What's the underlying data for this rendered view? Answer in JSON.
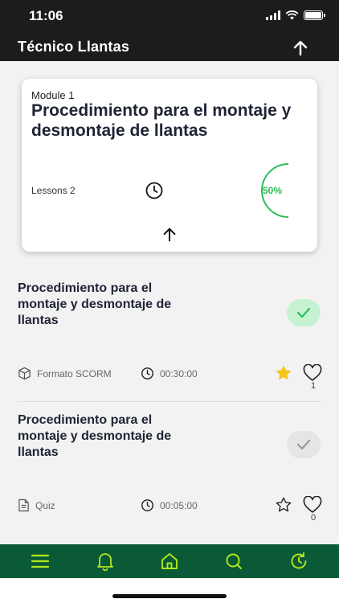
{
  "status_bar": {
    "time": "11:06"
  },
  "header": {
    "title": "Técnico Llantas"
  },
  "module": {
    "label": "Module 1",
    "title": "Procedimiento para el montaje y desmontaje de llantas",
    "lessons_text": "Lessons 2",
    "progress_text": "50%",
    "progress_fraction": 0.5
  },
  "lessons": [
    {
      "title": "Procedimiento para el montaje y desmontaje de llantas",
      "format": "Formato SCORM",
      "duration": "00:30:00",
      "completed": true,
      "favorited": true,
      "likes": "1"
    },
    {
      "title": "Procedimiento para el montaje y desmontaje de llantas",
      "format": "Quiz",
      "duration": "00:05:00",
      "completed": false,
      "favorited": false,
      "likes": "0"
    }
  ],
  "icons": {
    "format_scorm": "cube-icon",
    "format_quiz": "document-icon",
    "duration": "clock-icon",
    "favorite": "star-icon",
    "like": "heart-icon",
    "nav": [
      "menu-icon",
      "bell-icon",
      "home-icon",
      "search-icon",
      "history-icon"
    ]
  },
  "colors": {
    "header_bg": "#1c1c1c",
    "accent_green": "#2ebd59",
    "nav_bg": "#0b5a37",
    "nav_icon": "#b5e61d",
    "star": "#f5c518"
  }
}
